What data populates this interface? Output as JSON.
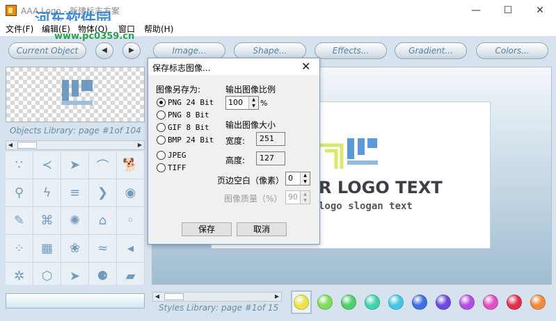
{
  "window": {
    "title": "AAA Logo - 新建标志方案",
    "watermark": "河东软件园",
    "watermark_url": "www.pc0359.cn",
    "min_glyph": "—",
    "max_glyph": "☐",
    "close_glyph": "✕"
  },
  "menu": [
    "文件(F)",
    "编辑(E)",
    "物体(O)",
    "窗口",
    "帮助(H)"
  ],
  "toolbar": {
    "current_object": "Current Object",
    "prev": "◀",
    "next": "▶",
    "tabs": [
      "Image...",
      "Shape...",
      "Effects...",
      "Gradient...",
      "Colors..."
    ]
  },
  "left_panel": {
    "objects_library_label": "Objects Library: page #1of 104",
    "styles_library_label": "Styles Library: page #1of 15",
    "shapes": [
      "∵",
      "≺",
      "➤",
      "⌒",
      "🐕",
      "⚲",
      "ϟ",
      "≡",
      "❯",
      "◉",
      "✎",
      "⌘",
      "✺",
      "⌂",
      "◦",
      "⁘",
      "▦",
      "❀",
      "≈",
      "◂",
      "✲",
      "⬡",
      "➤",
      "⚈",
      "▰"
    ],
    "scroll_left": "◀",
    "scroll_right": "▶"
  },
  "canvas": {
    "logo_text": "R LOGO TEXT",
    "slogan": "logo slogan text"
  },
  "swatches": [
    "#e8e54a",
    "#7fdc5a",
    "#4ecf6a",
    "#3fd3a9",
    "#45c6e6",
    "#3c6fe0",
    "#6b4be0",
    "#b24fe0",
    "#e04fc1",
    "#e0314f",
    "#ef8a3c"
  ],
  "dialog": {
    "title": "保存标志图像...",
    "close": "✕",
    "save_as_label": "图像另存为:",
    "formats": [
      "PNG 24 Bit",
      "PNG 8 Bit",
      "GIF 8 Bit",
      "BMP 24 Bit",
      "JPEG",
      "TIFF"
    ],
    "selected_format": "PNG 24 Bit",
    "ratio_label": "输出图像比例",
    "ratio_value": "100",
    "ratio_unit": "%",
    "size_label": "输出图像大小",
    "width_label": "宽度:",
    "width_value": "251",
    "height_label": "高度:",
    "height_value": "127",
    "margin_label": "页边空白（像素）",
    "margin_value": "0",
    "quality_label": "图像质量（%）",
    "quality_value": "90",
    "save_button": "保存",
    "cancel_button": "取消"
  }
}
